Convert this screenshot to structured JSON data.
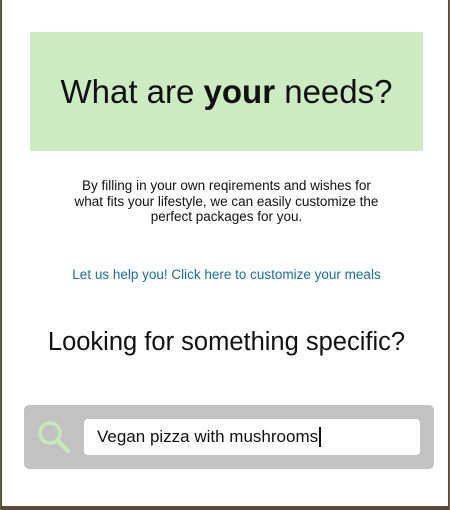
{
  "hero": {
    "title_before": "What are ",
    "title_bold": "your",
    "title_after": " needs?"
  },
  "intro": {
    "line1": "By filling in your own reqirements and wishes for",
    "line2": "what fits your lifestyle, we can easily customize the",
    "line3": "perfect packages for you."
  },
  "cta": {
    "label": "Let us help you! Click here to customize your meals"
  },
  "search_section": {
    "heading": "Looking for something specific?",
    "input_value": "Vegan pizza with mushrooms",
    "icon": "search-icon"
  },
  "colors": {
    "hero_background": "#cdebc2",
    "link": "#1a6f9a",
    "search_bar": "#c2c2c2",
    "search_icon": "#c7e8b8"
  }
}
